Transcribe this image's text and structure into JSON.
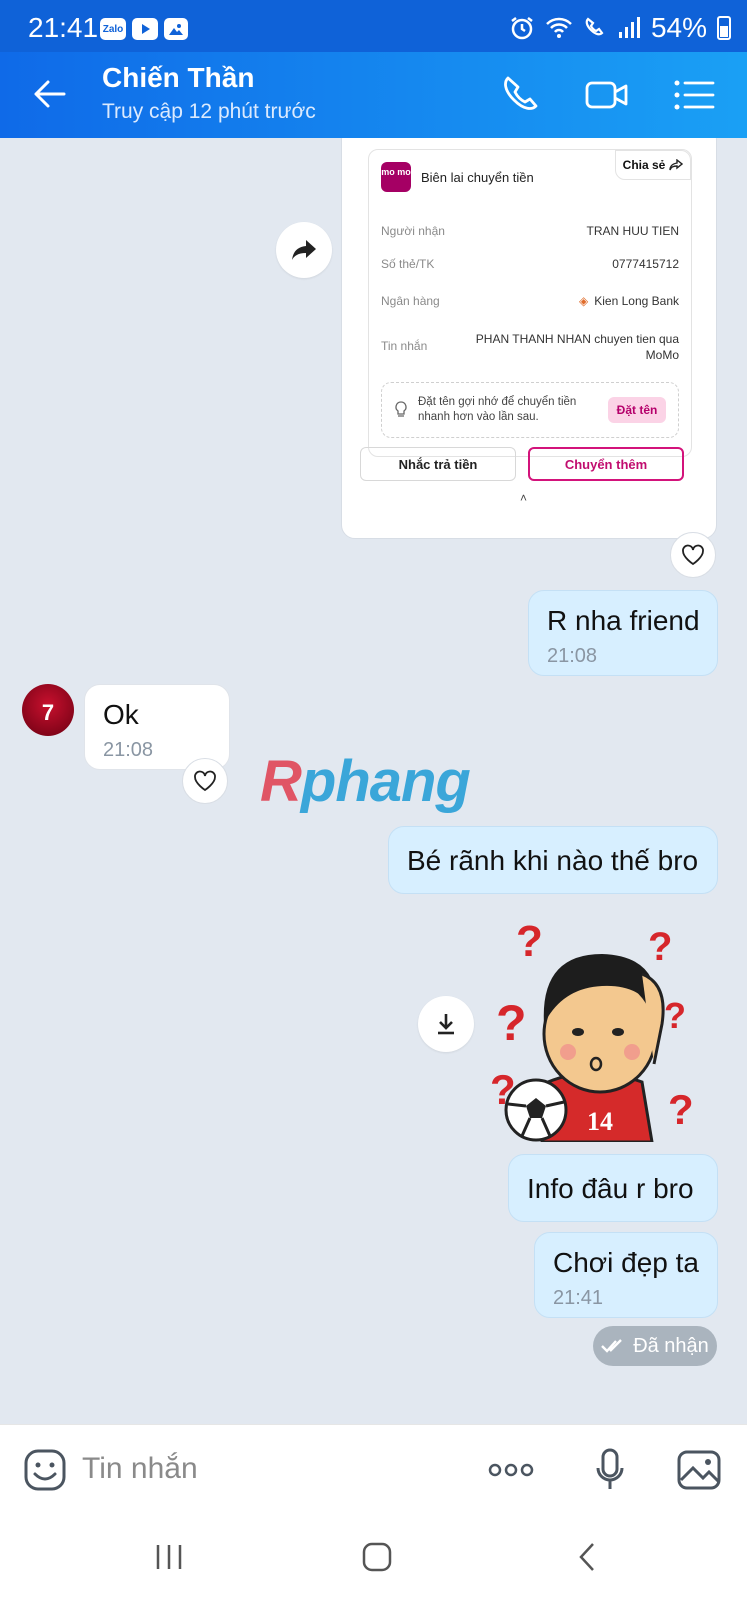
{
  "status_bar": {
    "time": "21:41",
    "app_icons": [
      "Zalo",
      "youtube-icon",
      "gallery-icon"
    ],
    "battery": "54%"
  },
  "header": {
    "name": "Chiến Thần",
    "status": "Truy cập 12 phút trước",
    "icons": [
      "back-arrow-icon",
      "phone-icon",
      "video-call-icon",
      "menu-list-icon"
    ]
  },
  "receipt": {
    "logo": "mo mo",
    "title": "Biên lai chuyển tiền",
    "share_label": "Chia sẻ",
    "rows": [
      {
        "label": "Người nhận",
        "value": "TRAN HUU TIEN"
      },
      {
        "label": "Số thẻ/TK",
        "value": "0777415712"
      },
      {
        "label": "Ngân hàng",
        "value": "Kien Long Bank"
      },
      {
        "label": "Tin nhắn",
        "value": "PHAN THANH NHAN chuyen tien qua MoMo"
      }
    ],
    "hint": "Đặt tên gợi nhớ để chuyển tiền nhanh hơn vào lần sau.",
    "hint_button": "Đặt tên",
    "remind_button": "Nhắc trả tiền",
    "transfer_more_button": "Chuyển thêm",
    "collapse": "˄"
  },
  "messages": [
    {
      "text": "R nha friend",
      "time": "21:08"
    },
    {
      "text": "Ok",
      "time": "21:08"
    },
    {
      "text": "Bé rãnh khi nào thế bro"
    },
    {
      "text": "Info đâu r bro"
    },
    {
      "text": "Chơi đẹp ta",
      "time": "21:41"
    }
  ],
  "avatar_text": "7",
  "sticker": {
    "jersey_number": "14"
  },
  "watermark": {
    "r": "R",
    "rest": "phang"
  },
  "read_status": "Đã nhận",
  "input": {
    "placeholder": "Tin nhắn",
    "icons": [
      "emoji-icon",
      "more-icon",
      "microphone-icon",
      "image-icon"
    ]
  },
  "nav": [
    "recent-apps-icon",
    "home-icon",
    "back-icon"
  ],
  "colors": {
    "header_blue": "#0f6ae8",
    "out_bubble": "#d7efff",
    "momo_pink": "#a50064",
    "chat_bg": "#e2e8f0"
  }
}
